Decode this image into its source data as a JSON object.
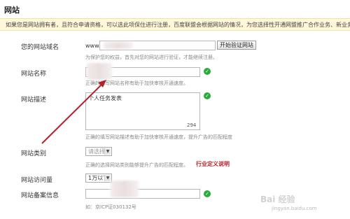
{
  "section_title": "网站",
  "notice": "如果您是网站拥有者，且符合申请资格，可以选此项保住进行注册，百度联盟会根据网站的情况，为您选择性开通网盟推广合作业务、新业务合作",
  "fields": {
    "domain": {
      "label": "您的网站域名",
      "prefix": "www.",
      "button": "开始验证网站",
      "hint": "为保护您的权益，首先对您的网站进行验证，才能继续注册。"
    },
    "name": {
      "label": "网站名称",
      "hint": "正确的填写网站名称有助于加快审核开通速度。"
    },
    "description": {
      "label": "网站描述",
      "value": "个人任务发表",
      "counter": "294",
      "hint": "正确的填写网站描述有助于加快审核开通速度，提升广告的匹配程度"
    },
    "category": {
      "label": "网站类别",
      "placeholder": "请选择",
      "hint": "正确的选择网站类别能够提升广告的匹配程度。",
      "link": "行业定义说明"
    },
    "traffic": {
      "label": "网站访问量",
      "value": "1万以下"
    },
    "record": {
      "label": "网站备案信息",
      "hint": "如：京ICP证030132号"
    }
  },
  "watermark": "Bai 经验",
  "watermark_url": "jingyan.baidu.com",
  "colors": {
    "notice_bg": "#fff8d8",
    "check_green": "#2bab3b",
    "arrow_red": "#b3222a"
  }
}
